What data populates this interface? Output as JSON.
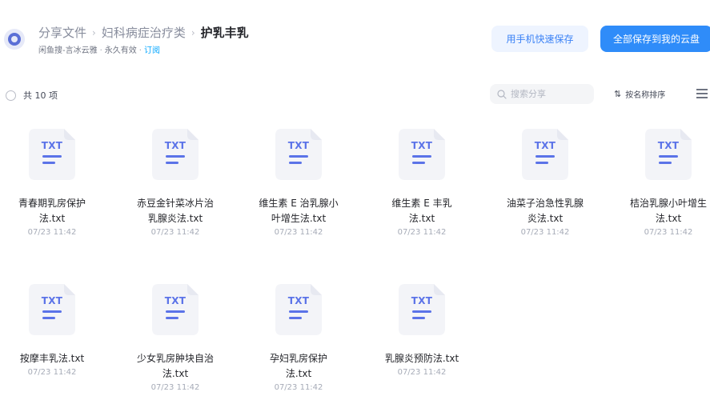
{
  "header": {
    "breadcrumbs": [
      "分享文件",
      "妇科病症治疗类"
    ],
    "current": "护乳丰乳",
    "meta": {
      "sharer": "闲鱼搜-言冰云雅",
      "validity": "永久有效",
      "subscribe": "订阅"
    },
    "buttons": {
      "phone_save": "用手机快速保存",
      "save_all": "全部保存到我的云盘"
    }
  },
  "toolbar": {
    "count_label": "共 10 项",
    "search_placeholder": "搜索分享",
    "sort_label": "按名称排序",
    "sort_icon": "sort-arrows-icon",
    "view_icon": "list-view-icon"
  },
  "file_type_label": "TXT",
  "files": [
    {
      "name_line1": "青春期乳房保护",
      "name_line2": "法.txt",
      "date": "07/23 11:42"
    },
    {
      "name_line1": "赤豆金针菜冰片治",
      "name_line2": "乳腺炎法.txt",
      "date": "07/23 11:42"
    },
    {
      "name_line1": "维生素 E 治乳腺小",
      "name_line2": "叶增生法.txt",
      "date": "07/23 11:42"
    },
    {
      "name_line1": "维生素 E 丰乳",
      "name_line2": "法.txt",
      "date": "07/23 11:42"
    },
    {
      "name_line1": "油菜子治急性乳腺",
      "name_line2": "炎法.txt",
      "date": "07/23 11:42"
    },
    {
      "name_line1": "桔治乳腺小叶增生",
      "name_line2": "法.txt",
      "date": "07/23 11:42"
    },
    {
      "name_line1": "按摩丰乳法.txt",
      "name_line2": "",
      "date": "07/23 11:42"
    },
    {
      "name_line1": "少女乳房肿块自治",
      "name_line2": "法.txt",
      "date": "07/23 11:42"
    },
    {
      "name_line1": "孕妇乳房保护",
      "name_line2": "法.txt",
      "date": "07/23 11:42"
    },
    {
      "name_line1": "乳腺炎预防法.txt",
      "name_line2": "",
      "date": "07/23 11:42"
    }
  ],
  "colors": {
    "accent": "#2f8cf9",
    "file_icon": "#5b73e8",
    "link": "#06a7ff"
  }
}
